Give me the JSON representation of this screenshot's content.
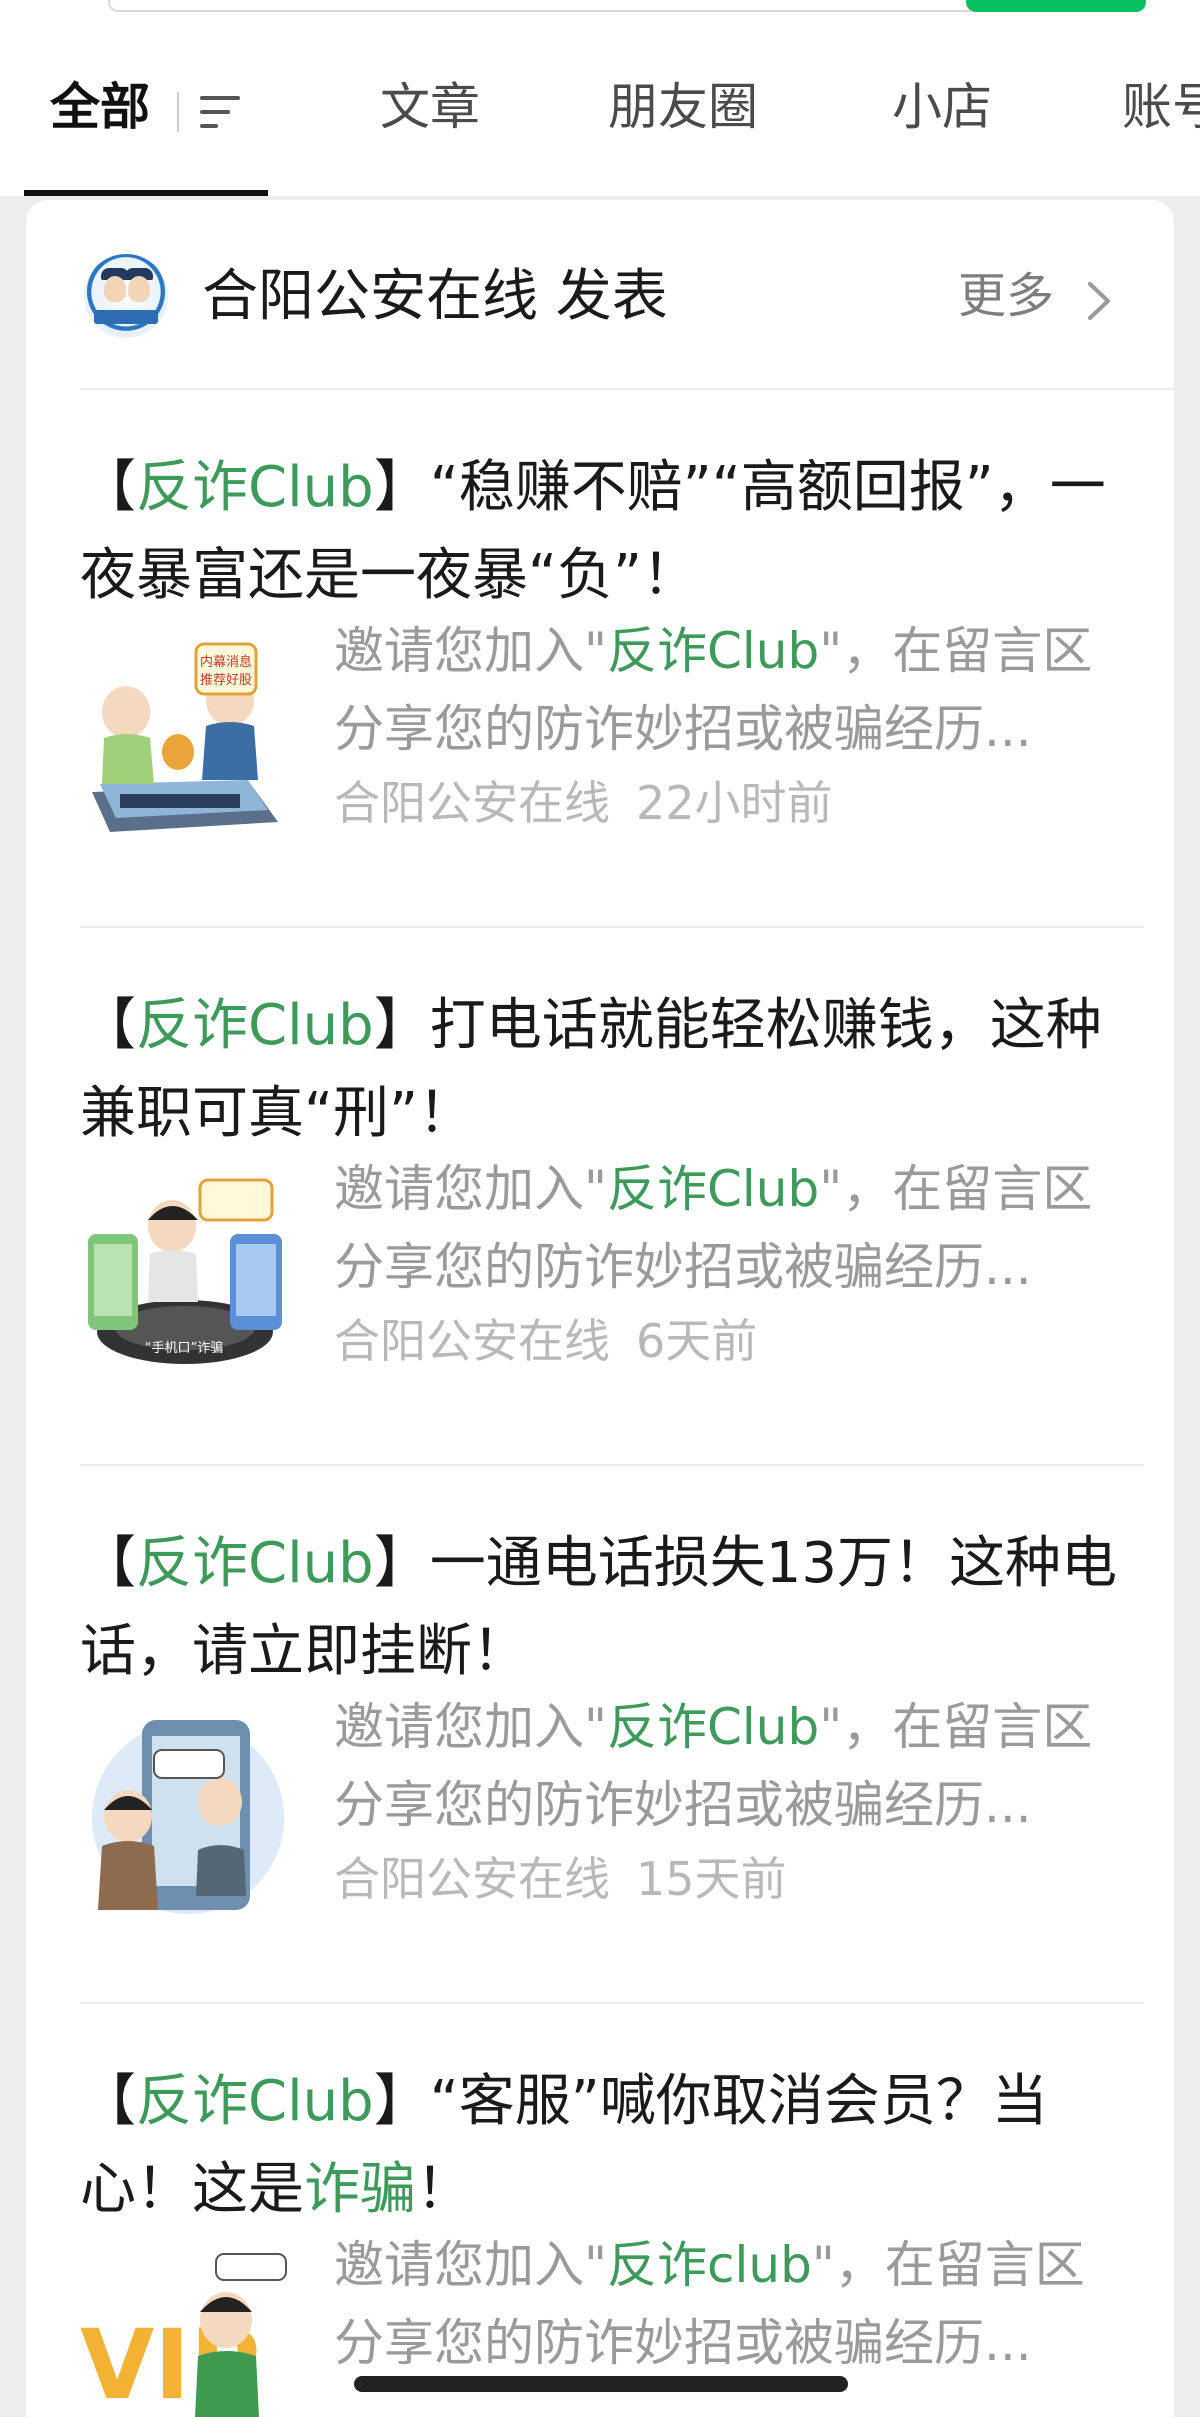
{
  "tabs": [
    {
      "label": "全部",
      "active": true
    },
    {
      "label": "文章",
      "active": false
    },
    {
      "label": "朋友圈",
      "active": false
    },
    {
      "label": "小店",
      "active": false
    },
    {
      "label": "账号",
      "active": false
    }
  ],
  "account": {
    "publisher_text": "合阳公安在线 发表",
    "more_label": "更多"
  },
  "articles": [
    {
      "title_prefix": "【",
      "title_club": "反诈Club",
      "title_rest": "】“稳赚不赔”“高额回报”，一夜暴富还是一夜暴“负”！",
      "desc_before": "邀请您加入\"",
      "desc_club": "反诈Club",
      "desc_after": "\"，在留言区分享您的防诈妙招或被骗经历...",
      "source": "合阳公安在线",
      "time": "22小时前",
      "thumb_icon": "investment-scam-illustration"
    },
    {
      "title_prefix": "【",
      "title_club": "反诈Club",
      "title_rest": "】打电话就能轻松赚钱，这种兼职可真“刑”！",
      "desc_before": "邀请您加入\"",
      "desc_club": "反诈Club",
      "desc_after": "\"，在留言区分享您的防诈妙招或被骗经历...",
      "source": "合阳公安在线",
      "time": "6天前",
      "thumb_icon": "phone-job-scam-illustration"
    },
    {
      "title_prefix": "【",
      "title_club": "反诈Club",
      "title_rest": "】一通电话损失13万！这种电话，请立即挂断！",
      "desc_before": "邀请您加入\"",
      "desc_club": "反诈Club",
      "desc_after": "\"，在留言区分享您的防诈妙招或被骗经历...",
      "source": "合阳公安在线",
      "time": "15天前",
      "thumb_icon": "phone-call-scam-illustration"
    },
    {
      "title_prefix": "【",
      "title_club": "反诈Club",
      "title_mid": "】“客服”喊你取消会员？当心！这是",
      "title_scam": "诈骗",
      "title_end": "！",
      "desc_before": "邀请您加入\"",
      "desc_club": "反诈club",
      "desc_after": "\"，在留言区分享您的防诈妙招或被骗经历...",
      "thumb_icon": "vip-cancel-scam-illustration"
    }
  ],
  "colors": {
    "accent_green": "#3d9a5a",
    "search_button_green": "#07c160"
  }
}
